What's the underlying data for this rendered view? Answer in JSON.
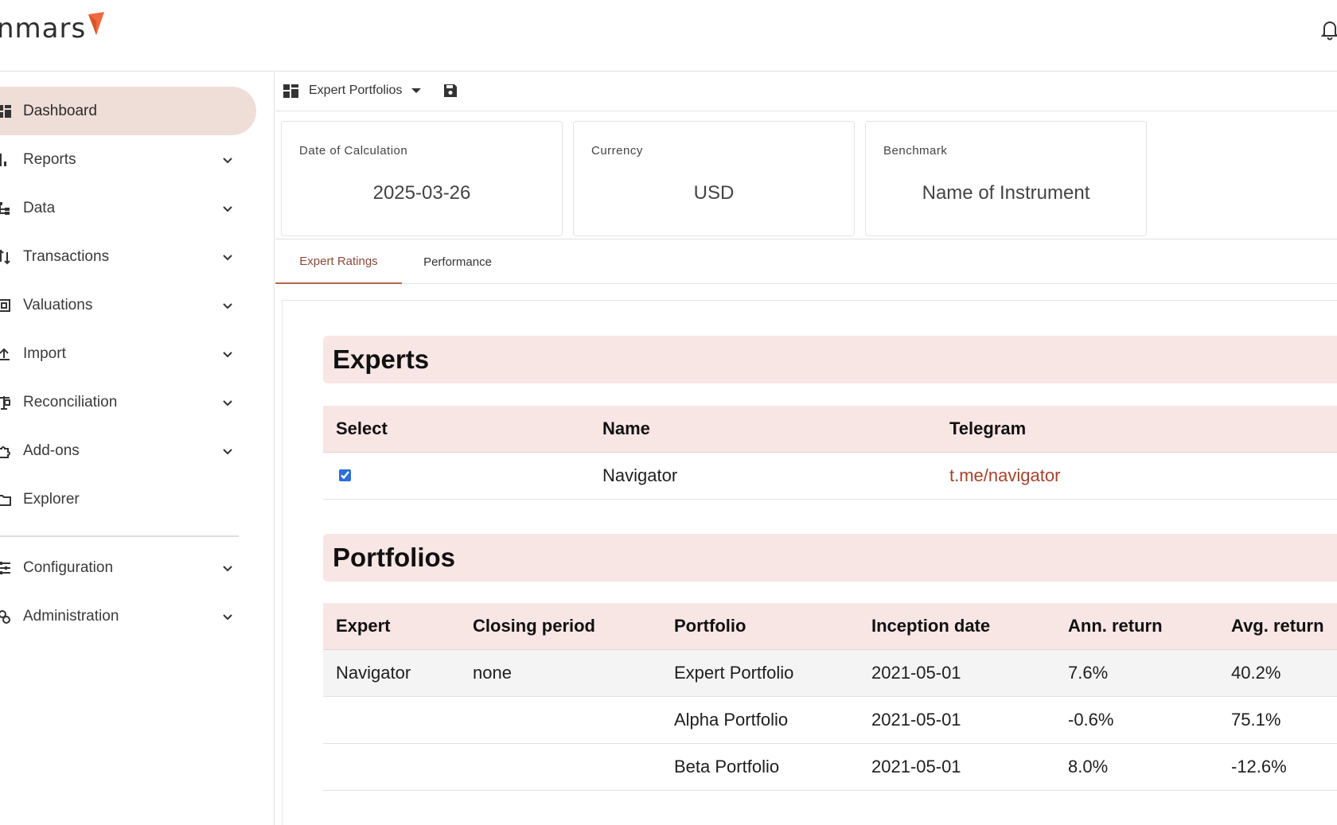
{
  "app": {
    "logo_text": "nmars"
  },
  "sidebar": {
    "items": [
      {
        "label": "Dashboard",
        "icon": "dashboard-icon",
        "active": true
      },
      {
        "label": "Reports",
        "icon": "bar-chart-icon"
      },
      {
        "label": "Data",
        "icon": "data-tree-icon"
      },
      {
        "label": "Transactions",
        "icon": "swap-vertical-icon"
      },
      {
        "label": "Valuations",
        "icon": "valuation-icon"
      },
      {
        "label": "Import",
        "icon": "upload-icon"
      },
      {
        "label": "Reconciliation",
        "icon": "balance-icon"
      },
      {
        "label": "Add-ons",
        "icon": "puzzle-icon"
      },
      {
        "label": "Explorer",
        "icon": "folder-icon"
      },
      {
        "label": "Configuration",
        "icon": "sliders-icon"
      },
      {
        "label": "Administration",
        "icon": "admin-gear-icon"
      }
    ]
  },
  "toolbar": {
    "title": "Expert Portfolios"
  },
  "cards": [
    {
      "label": "Date of Calculation",
      "value": "2025-03-26"
    },
    {
      "label": "Currency",
      "value": "USD"
    },
    {
      "label": "Benchmark",
      "value": "Name of Instrument"
    }
  ],
  "tabs": [
    {
      "label": "Expert Ratings",
      "active": true
    },
    {
      "label": "Performance"
    }
  ],
  "experts": {
    "title": "Experts",
    "columns": [
      "Select",
      "Name",
      "Telegram"
    ],
    "rows": [
      {
        "selected": true,
        "name": "Navigator",
        "telegram": "t.me/navigator"
      }
    ]
  },
  "portfolios": {
    "title": "Portfolios",
    "columns": [
      "Expert",
      "Closing period",
      "Portfolio",
      "Inception date",
      "Ann. return",
      "Avg. return"
    ],
    "rows": [
      [
        "Navigator",
        "none",
        "Expert Portfolio",
        "2021-05-01",
        "7.6%",
        "40.2%"
      ],
      [
        "",
        "",
        "Alpha Portfolio",
        "2021-05-01",
        "-0.6%",
        "75.1%"
      ],
      [
        "",
        "",
        "Beta Portfolio",
        "2021-05-01",
        "8.0%",
        "-12.6%"
      ]
    ]
  },
  "colors": {
    "accent": "#b5654e",
    "logo_mark": "#f06a3e",
    "active_nav_bg": "#efddd8",
    "section_bg": "#f8e6e4",
    "link": "#a5432b"
  }
}
